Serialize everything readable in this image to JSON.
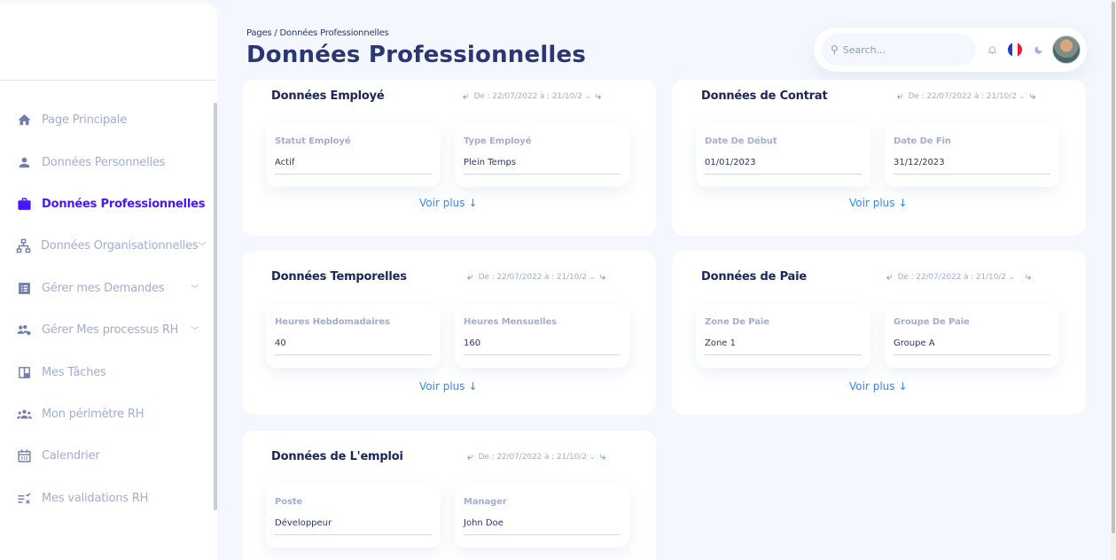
{
  "breadcrumb": "Pages  /  Données Professionnelles",
  "page_title": "Données Professionnelles",
  "search": {
    "placeholder": "Search..."
  },
  "colors": {
    "accent": "#4318ff",
    "link": "#3a86f6",
    "muted": "#a3aed0",
    "title": "#2b3674"
  },
  "sidebar": {
    "items": [
      {
        "label": "Page Principale",
        "icon": "home-icon",
        "active": false,
        "has_chevron": false
      },
      {
        "label": "Données Personnelles",
        "icon": "person-icon",
        "active": false,
        "has_chevron": false
      },
      {
        "label": "Données Professionnelles",
        "icon": "briefcase-icon",
        "active": true,
        "has_chevron": false
      },
      {
        "label": "Données Organisationnelles",
        "icon": "org-chart-icon",
        "active": false,
        "has_chevron": true
      },
      {
        "label": "Gérer mes Demandes",
        "icon": "list-icon",
        "active": false,
        "has_chevron": true
      },
      {
        "label": "Gérer Mes processus RH",
        "icon": "people-gear-icon",
        "active": false,
        "has_chevron": true
      },
      {
        "label": "Mes Tâches",
        "icon": "board-icon",
        "active": false,
        "has_chevron": false
      },
      {
        "label": "Mon périmètre RH",
        "icon": "group-icon",
        "active": false,
        "has_chevron": false
      },
      {
        "label": "Calendrier",
        "icon": "calendar-icon",
        "active": false,
        "has_chevron": false
      },
      {
        "label": "Mes validations RH",
        "icon": "checklist-icon",
        "active": false,
        "has_chevron": false
      }
    ]
  },
  "date_range_label": "De : 22/07/2022 à : 21/10/2",
  "see_more_label": "Voir plus",
  "cards": {
    "employe": {
      "title": "Données Employé",
      "fields": [
        {
          "label": "Statut Employé",
          "value": "Actif"
        },
        {
          "label": "Type Employé",
          "value": "Plein Temps"
        }
      ]
    },
    "contrat": {
      "title": "Données de Contrat",
      "fields": [
        {
          "label": "Date De Début",
          "value": "01/01/2023"
        },
        {
          "label": "Date De Fin",
          "value": "31/12/2023"
        }
      ]
    },
    "temporelles": {
      "title": "Données Temporelles",
      "fields": [
        {
          "label": "Heures Hebdomadaires",
          "value": "40"
        },
        {
          "label": "Heures Mensuelles",
          "value": "160"
        }
      ]
    },
    "paie": {
      "title": "Données de Paie",
      "fields": [
        {
          "label": "Zone De Paie",
          "value": "Zone 1"
        },
        {
          "label": "Groupe De Paie",
          "value": "Groupe A"
        }
      ]
    },
    "emploi": {
      "title": "Données de L'emploi",
      "fields": [
        {
          "label": "Poste",
          "value": "Développeur"
        },
        {
          "label": "Manager",
          "value": "John Doe"
        }
      ]
    }
  }
}
